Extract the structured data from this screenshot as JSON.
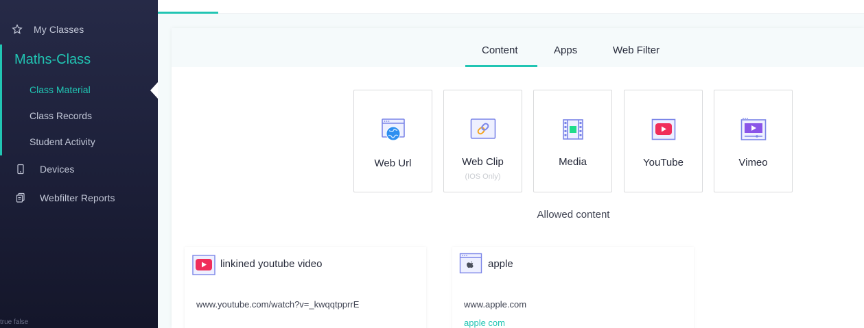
{
  "sidebar": {
    "my_classes": "My Classes",
    "class_name": "Maths-Class",
    "sub_items": [
      "Class Material",
      "Class Records",
      "Student Activity"
    ],
    "devices": "Devices",
    "webfilter_reports": "Webfilter Reports",
    "debug_text": "true false"
  },
  "tabs": [
    "Content",
    "Apps",
    "Web Filter"
  ],
  "cards": [
    {
      "label": "Web Url",
      "icon": "web-url-icon"
    },
    {
      "label": "Web Clip",
      "sublabel": "(IOS Only)",
      "icon": "web-clip-icon"
    },
    {
      "label": "Media",
      "icon": "media-icon"
    },
    {
      "label": "YouTube",
      "icon": "youtube-icon"
    },
    {
      "label": "Vimeo",
      "icon": "vimeo-icon"
    }
  ],
  "allowed_title": "Allowed content",
  "items": [
    {
      "title": "linkined youtube video",
      "url": "www.youtube.com/watch?v=_kwqqtpprrE"
    },
    {
      "title": "apple",
      "url": "www.apple.com",
      "link": "apple com"
    }
  ],
  "colors": {
    "accent": "#21c5b3",
    "sidebar_bg": "#1c1f38",
    "youtube_red": "#f02e5a",
    "vimeo_purple": "#8a55e8"
  }
}
